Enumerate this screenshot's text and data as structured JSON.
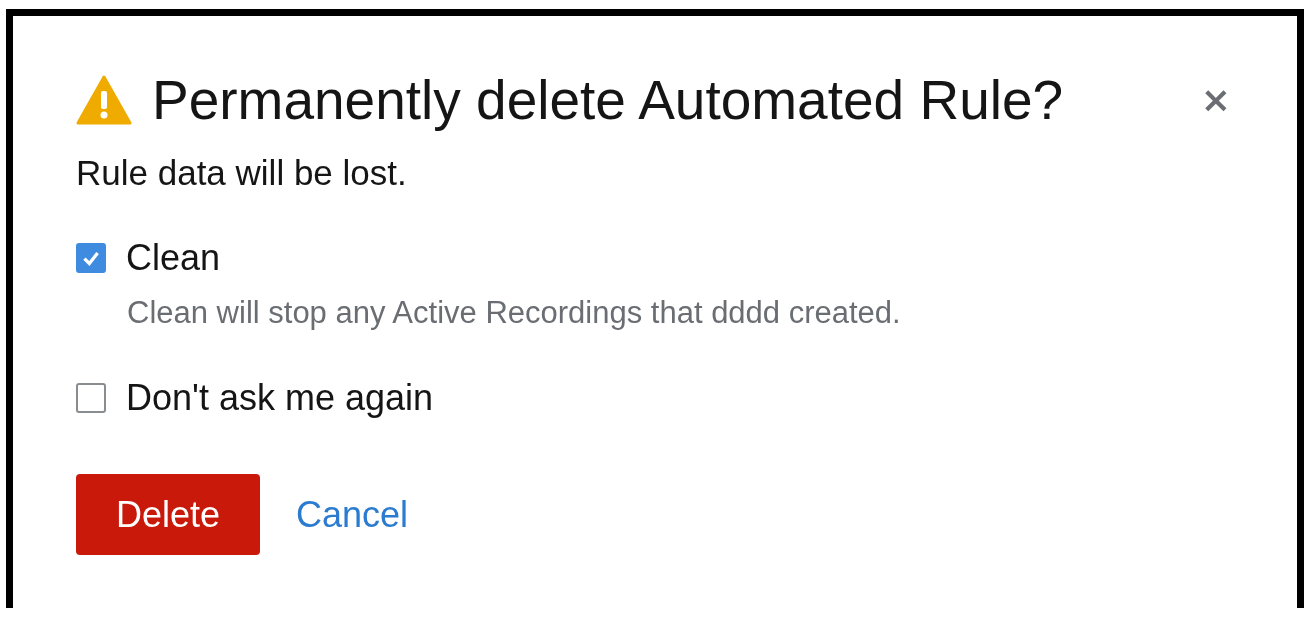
{
  "dialog": {
    "title": "Permanently delete Automated Rule?",
    "close": "×",
    "description": "Rule data will be lost.",
    "options": [
      {
        "label": "Clean",
        "checked": true,
        "helper": "Clean will stop any Active Recordings that dddd created."
      },
      {
        "label": "Don't ask me again",
        "checked": false
      }
    ],
    "actions": [
      {
        "kind": "danger",
        "label": "Delete"
      },
      {
        "kind": "link",
        "label": "Cancel"
      }
    ]
  }
}
